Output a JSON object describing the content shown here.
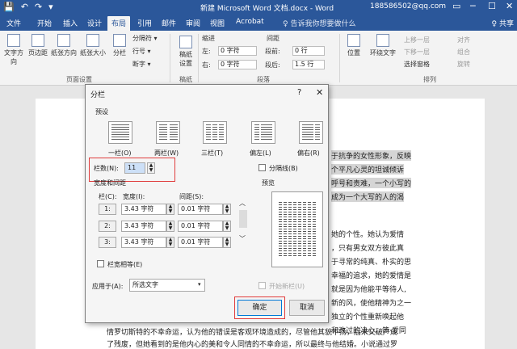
{
  "titlebar": {
    "doc_title": "新建 Microsoft Word 文档.docx - Word",
    "account": "188586502@qq.com",
    "quick_access": [
      "💾",
      "↶",
      "↷",
      "▾"
    ],
    "window_buttons": [
      "▭",
      "─",
      "☐",
      "✕"
    ]
  },
  "tabs": [
    "文件",
    "开始",
    "插入",
    "设计",
    "布局",
    "引用",
    "邮件",
    "审阅",
    "视图",
    "Acrobat"
  ],
  "active_tab": "布局",
  "tell_me": "♀ 告诉我你想要做什么",
  "share": "♀ 共享",
  "ribbon": {
    "page_setup_buttons": [
      "文字方向",
      "页边距",
      "纸张方向",
      "纸张大小",
      "分栏"
    ],
    "breaks": "分隔符 ▾",
    "line_numbers": "行号 ▾",
    "hyphenation": "断字 ▾",
    "manuscript": "稿纸\n设置",
    "group_page_setup": "页面设置",
    "group_manuscript": "稿纸",
    "indent_label": "缩进",
    "spacing_label": "间距",
    "indent_left_label": "左:",
    "indent_left_value": "0 字符",
    "indent_right_label": "右:",
    "indent_right_value": "0 字符",
    "spacing_before_label": "段前:",
    "spacing_before_value": "0 行",
    "spacing_after_label": "段后:",
    "spacing_after_value": "1.5 行",
    "group_paragraph": "段落",
    "position": "位置",
    "wrap_text": "环绕文字",
    "bring_forward": "上移一层",
    "send_backward": "下移一层",
    "selection_pane": "选择窗格",
    "align": "对齐",
    "group": "组合",
    "rotate": "旋转",
    "group_arrange": "排列"
  },
  "document": {
    "right_lines": [
      "于抗争的女性形象，反映",
      "个平凡心灵的坦诚倾诉",
      "呼号和责难，一个小写的",
      "成为一个大写的人的渴"
    ],
    "mid_lines": [
      "她的个性。她认为爱情",
      "，只有男女双方彼此真",
      "于寻常的纯真、朴实的思",
      "幸福的追求，她的爱情是",
      "就是因为他能平等待人,",
      "新的风，使他精神为之一",
      "独立的个性重新唤起他",
      "和改过的决心。简·爱同"
    ],
    "bottom_lines": [
      "情罗切斯特的不幸命运，认为他的错误是客观环境造成的，尽管他其貌不扬，后来又破产成",
      "了残废，但她看到的是他内心的美和令人同情的不幸命运，所以最终与他结婚。小说通过罗"
    ]
  },
  "dialog": {
    "title": "分栏",
    "help": "?",
    "close": "✕",
    "presets_label": "预设",
    "presets": [
      "一栏(O)",
      "两栏(W)",
      "三栏(T)",
      "偏左(L)",
      "偏右(R)"
    ],
    "columns_label": "栏数(N):",
    "columns_value": "11",
    "separator_label": "分隔线(B)",
    "width_spacing_label": "宽度和间距",
    "preview_label": "预览",
    "col_header": "栏(C):",
    "width_header": "宽度(I):",
    "spacing_header": "间距(S):",
    "rows": [
      {
        "num": "1:",
        "width": "3.43 字符",
        "spacing": "0.01 字符"
      },
      {
        "num": "2:",
        "width": "3.43 字符",
        "spacing": "0.01 字符"
      },
      {
        "num": "3:",
        "width": "3.43 字符",
        "spacing": "0.01 字符"
      }
    ],
    "equal_width_label": "栏宽相等(E)",
    "apply_to_label": "应用于(A):",
    "apply_to_value": "所选文字",
    "new_column_label": "开始新栏(U)",
    "ok": "确定",
    "cancel": "取消"
  },
  "colors": {
    "word_blue": "#2b579a",
    "highlight_red": "#e03c3c",
    "focus_blue": "#0078d7"
  }
}
